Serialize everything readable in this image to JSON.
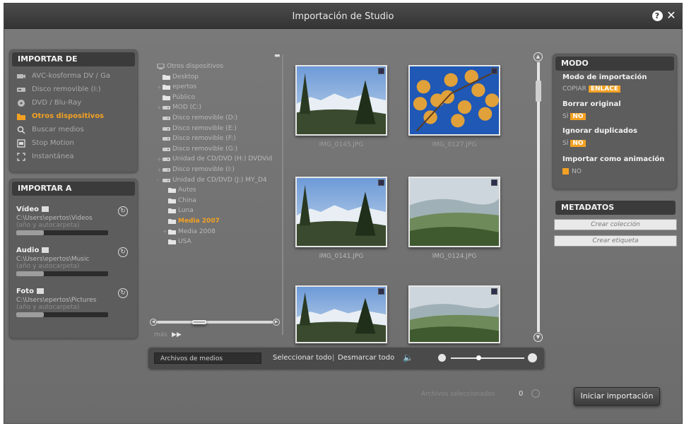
{
  "window": {
    "title": "Importación de Studio"
  },
  "import_from": {
    "title": "IMPORTAR DE",
    "items": [
      {
        "label": "AVC-kosforma DV / Ga",
        "icon": "camcorder-icon"
      },
      {
        "label": "Disco removible (I:)",
        "icon": "removable-disk-icon"
      },
      {
        "label": "DVD / Blu-Ray",
        "icon": "disc-icon"
      },
      {
        "label": "Otros dispositivos",
        "icon": "folder-icon",
        "active": true
      },
      {
        "label": "Buscar medios",
        "icon": "search-icon"
      },
      {
        "label": "Stop Motion",
        "icon": "stop-motion-icon"
      },
      {
        "label": "Instantánea",
        "icon": "snapshot-icon"
      }
    ]
  },
  "import_to": {
    "title": "IMPORTAR A",
    "destinations": [
      {
        "name": "Vídeo",
        "path": "C:\\Users\\epertos\\Videos",
        "sub": "(año y autocarpeta)"
      },
      {
        "name": "Audio",
        "path": "C:\\Users\\epertos\\Music",
        "sub": "(año y autocarpeta)"
      },
      {
        "name": "Foto",
        "path": "C:\\Users\\epertos\\Pictures",
        "sub": "(año y autocarpeta)"
      }
    ]
  },
  "tree": {
    "nodes": [
      {
        "label": "Otros dispositivos",
        "level": 0,
        "twisty": "",
        "icon": "computer"
      },
      {
        "label": "Desktop",
        "level": 1,
        "twisty": "",
        "icon": "folder"
      },
      {
        "label": "epertos",
        "level": 1,
        "twisty": "+",
        "icon": "folder"
      },
      {
        "label": "Público",
        "level": 1,
        "twisty": "",
        "icon": "folder"
      },
      {
        "label": "MOD (C:)",
        "level": 1,
        "twisty": "+",
        "icon": "drive"
      },
      {
        "label": "Disco removible (D:)",
        "level": 1,
        "twisty": "",
        "icon": "drive"
      },
      {
        "label": "Disco removible (E:)",
        "level": 1,
        "twisty": "",
        "icon": "drive"
      },
      {
        "label": "Disco removible (F:)",
        "level": 1,
        "twisty": "",
        "icon": "drive"
      },
      {
        "label": "Disco removible (G:)",
        "level": 1,
        "twisty": "",
        "icon": "drive"
      },
      {
        "label": "Unidad de CD/DVD (H:) DVDVid",
        "level": 1,
        "twisty": "+",
        "icon": "drive"
      },
      {
        "label": "Disco removible (I:)",
        "level": 1,
        "twisty": "+",
        "icon": "drive"
      },
      {
        "label": "Unidad de CD/DVD (J:) MY_D4",
        "level": 1,
        "twisty": "-",
        "icon": "drive"
      },
      {
        "label": "Autos",
        "level": 2,
        "twisty": "",
        "icon": "folder"
      },
      {
        "label": "China",
        "level": 2,
        "twisty": "",
        "icon": "folder"
      },
      {
        "label": "Luna",
        "level": 2,
        "twisty": "",
        "icon": "folder"
      },
      {
        "label": "Media 2007",
        "level": 2,
        "twisty": "",
        "icon": "folder",
        "selected": true
      },
      {
        "label": "Media 2008",
        "level": 2,
        "twisty": "+",
        "icon": "folder"
      },
      {
        "label": "USA",
        "level": 2,
        "twisty": "",
        "icon": "folder"
      }
    ],
    "more_label": "más"
  },
  "thumbnails": [
    {
      "caption": "IMG_0145.JPG",
      "scene": "mountain-tree"
    },
    {
      "caption": "IMG_0127.JPG",
      "scene": "autumn-leaves"
    },
    {
      "caption": "IMG_0141.JPG",
      "scene": "mountain-tree"
    },
    {
      "caption": "IMG_0124.JPG",
      "scene": "valley"
    },
    {
      "caption": "",
      "scene": "mountain-tree"
    },
    {
      "caption": "",
      "scene": "valley"
    }
  ],
  "toolbar": {
    "media_filter": "Archivos de medios",
    "select_all": "Seleccionar todo",
    "separator": "|",
    "deselect_all": "Desmarcar todo"
  },
  "mode": {
    "title": "MODO",
    "import_mode_label": "Modo de importación",
    "copy_label": "COPIAR",
    "link_label": "ENLACE",
    "delete_original_label": "Borrar original",
    "delete_original_yes": "SÍ",
    "delete_original_no": "NO",
    "ignore_duplicates_label": "Ignorar duplicados",
    "ignore_duplicates_yes": "SÍ",
    "ignore_duplicates_no": "NO",
    "import_as_animation_label": "Importar como animación",
    "import_as_animation_no": "NO"
  },
  "metadata": {
    "title": "METADATOS",
    "create_collection": "Crear colección",
    "create_tag": "Crear etiqueta"
  },
  "footer": {
    "auto_delete_label": "Archivos seleccionados",
    "auto_delete_count": "0",
    "start_import": "Iniciar importación"
  },
  "colors": {
    "accent": "#f3a122",
    "panel": "#5d5d5d",
    "header": "#3b3b3b"
  }
}
